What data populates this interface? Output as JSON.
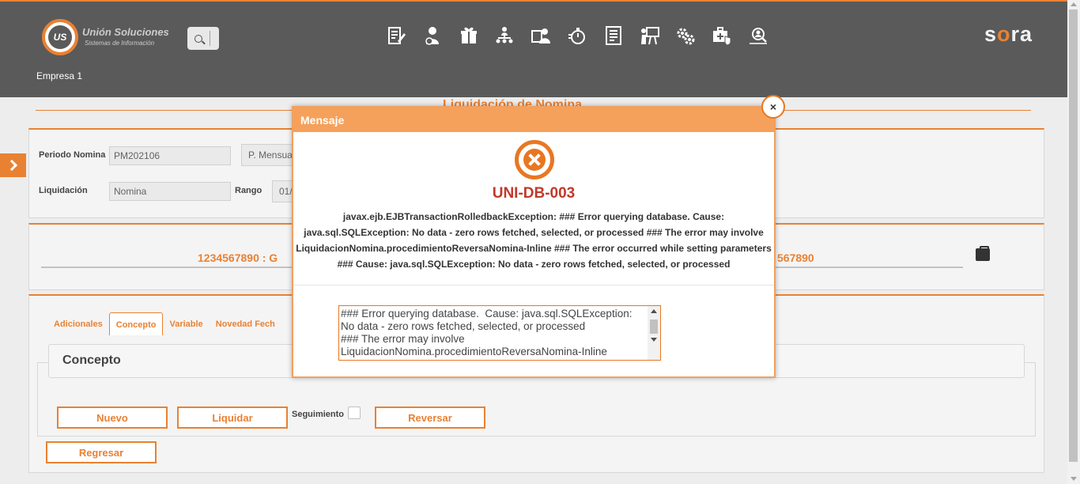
{
  "header": {
    "logo_name": "Unión Soluciones",
    "logo_sub": "Sistemas de Información",
    "logo_mark": "US",
    "brand": "sora",
    "company": "Empresa 1",
    "accent": "#e87722",
    "background": "#4d4d4d",
    "nav_icons": [
      "document-edit-icon",
      "user-money-icon",
      "gift-icon",
      "org-chart-icon",
      "user-card-icon",
      "stopwatch-icon",
      "report-list-icon",
      "presentation-icon",
      "gears-icon",
      "medical-bag-icon",
      "user-search-icon"
    ]
  },
  "page": {
    "title": "Liquidación de Nomina"
  },
  "form": {
    "periodo_label": "Periodo Nomina",
    "periodo_value": "PM202106",
    "periodo_tipo": "P. Mensua",
    "liquidacion_label": "Liquidación",
    "liquidacion_value": "Nomina",
    "rango_label": "Rango",
    "rango_value": "01/"
  },
  "employee": {
    "left_text": "1234567890 : G",
    "right_text": "567890"
  },
  "tabs": [
    {
      "label": "Adicionales"
    },
    {
      "label": "Concepto"
    },
    {
      "label": "Variable"
    },
    {
      "label": "Novedad Fech"
    }
  ],
  "concepto": {
    "title": "Concepto",
    "nuevo": "Nuevo",
    "liquidar": "Liquidar",
    "seguimiento": "Seguimiento",
    "reversar": "Reversar",
    "regresar": "Regresar"
  },
  "dialog": {
    "title": "Mensaje",
    "close": "×",
    "code": "UNI-DB-003",
    "message_lines": [
      "javax.ejb.EJBTransactionRolledbackException: ### Error querying database. Cause:",
      "java.sql.SQLException: No data - zero rows fetched, selected, or processed ### The error may involve",
      "LiquidacionNomina.procedimientoReversaNomina-Inline ### The error occurred while setting parameters",
      "### Cause: java.sql.SQLException: No data - zero rows fetched, selected, or processed"
    ],
    "detail": "### Error querying database.  Cause: java.sql.SQLException: No data - zero rows fetched, selected, or processed\n### The error may involve LiquidacionNomina.procedimientoReversaNomina-Inline"
  }
}
